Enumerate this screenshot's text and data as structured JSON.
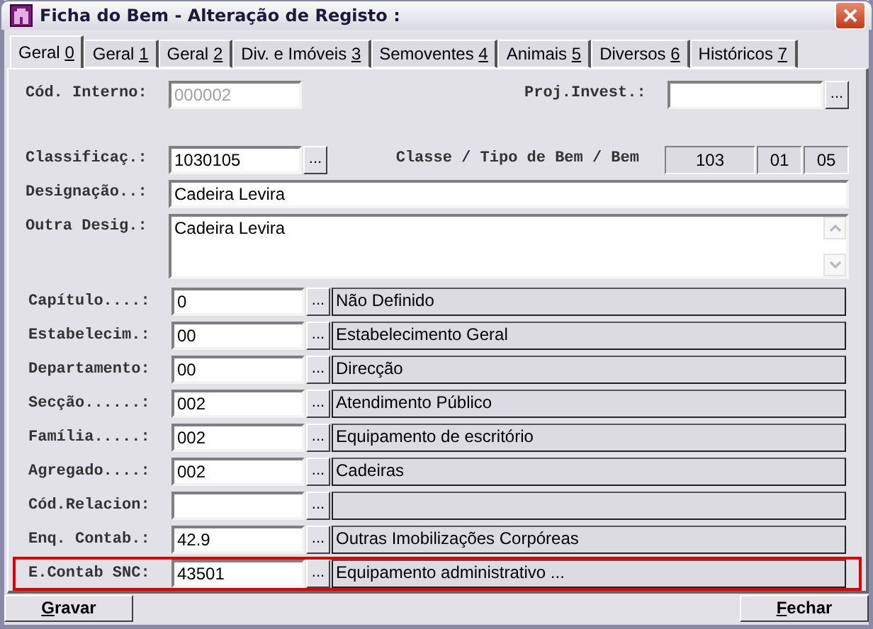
{
  "window": {
    "title": "Ficha do Bem - Alteração de Registo :"
  },
  "tabs": [
    {
      "label": "Geral",
      "mnemonic": "0",
      "selected": true
    },
    {
      "label": "Geral",
      "mnemonic": "1",
      "selected": false
    },
    {
      "label": "Geral",
      "mnemonic": "2",
      "selected": false
    },
    {
      "label": "Div. e Imóveis",
      "mnemonic": "3",
      "selected": false
    },
    {
      "label": "Semoventes",
      "mnemonic": "4",
      "selected": false
    },
    {
      "label": "Animais",
      "mnemonic": "5",
      "selected": false
    },
    {
      "label": "Diversos",
      "mnemonic": "6",
      "selected": false
    },
    {
      "label": "Históricos",
      "mnemonic": "7",
      "selected": false
    }
  ],
  "cod_interno": {
    "label": "Cód. Interno:",
    "value": "000002",
    "disabled": true
  },
  "proj_invest": {
    "label": "Proj.Invest.:",
    "button": "..."
  },
  "classificacao": {
    "label": "Classificaç.:",
    "value": "1030105",
    "button": "...",
    "classe_label": "Classe / Tipo de Bem / Bem",
    "classe_values": [
      "103",
      "01",
      "05"
    ]
  },
  "designacao": {
    "label": "Designação..:",
    "value": "Cadeira Levira"
  },
  "outra_desig": {
    "label": "Outra Desig.:",
    "value": "Cadeira Levira"
  },
  "lookups": [
    {
      "label": "Capítulo....:",
      "code": "0",
      "button": "...",
      "description": "Não Definido",
      "highlighted": false
    },
    {
      "label": "Estabelecim.:",
      "code": "00",
      "button": "...",
      "description": "Estabelecimento Geral",
      "highlighted": false
    },
    {
      "label": "Departamento:",
      "code": "00",
      "button": "...",
      "description": "Direcção",
      "highlighted": false
    },
    {
      "label": "Secção......:",
      "code": "002",
      "button": "...",
      "description": "Atendimento Público",
      "highlighted": false
    },
    {
      "label": "Família.....:",
      "code": "002",
      "button": "...",
      "description": "Equipamento de escritório",
      "highlighted": false
    },
    {
      "label": "Agregado....:",
      "code": "002",
      "button": "...",
      "description": "Cadeiras",
      "highlighted": false
    },
    {
      "label": "Cód.Relacion:",
      "button": "...",
      "highlighted": false
    },
    {
      "label": "Enq. Contab.:",
      "code": "42.9",
      "button": "...",
      "description": "Outras Imobilizações Corpóreas",
      "highlighted": false
    },
    {
      "label": "E.Contab SNC:",
      "code": "43501",
      "button": "...",
      "description": "Equipamento administrativo ...",
      "highlighted": true
    }
  ],
  "buttons": [
    {
      "mnemonic": "G",
      "rest": "ravar"
    },
    {
      "mnemonic": "F",
      "rest": "echar"
    }
  ]
}
